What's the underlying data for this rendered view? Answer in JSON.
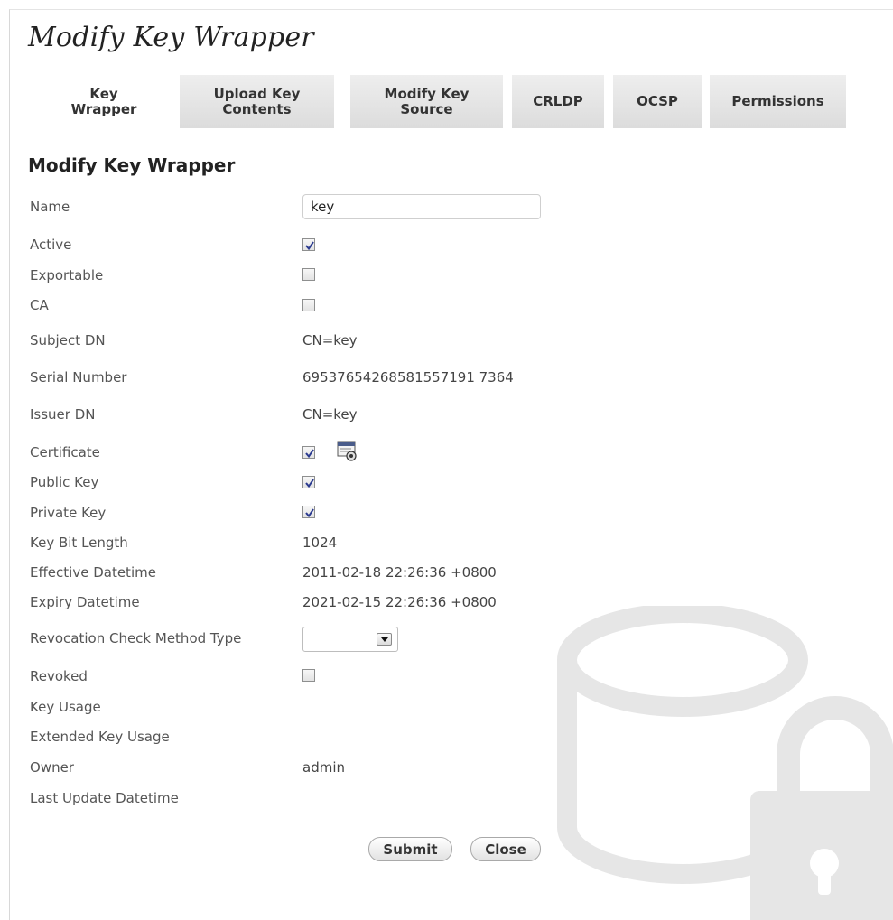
{
  "page": {
    "title": "Modify Key Wrapper"
  },
  "tabs": [
    {
      "label": "Key\nWrapper",
      "active": true
    },
    {
      "label": "Upload Key\nContents"
    },
    {
      "label": "Modify Key\nSource"
    },
    {
      "label": "CRLDP"
    },
    {
      "label": "OCSP"
    },
    {
      "label": "Permissions"
    }
  ],
  "form": {
    "section_title": "Modify Key Wrapper",
    "name": {
      "label": "Name",
      "value": "key"
    },
    "active": {
      "label": "Active",
      "checked": true
    },
    "exportable": {
      "label": "Exportable",
      "checked": false
    },
    "ca": {
      "label": "CA",
      "checked": false
    },
    "subject_dn": {
      "label": "Subject DN",
      "value": "CN=key"
    },
    "serial_number": {
      "label": "Serial Number",
      "value": "69537654268581557191 7364"
    },
    "issuer_dn": {
      "label": "Issuer DN",
      "value": "CN=key"
    },
    "certificate": {
      "label": "Certificate",
      "checked": true,
      "icon": "certificate-view-icon"
    },
    "public_key": {
      "label": "Public Key",
      "checked": true
    },
    "private_key": {
      "label": "Private Key",
      "checked": true
    },
    "key_bit_length": {
      "label": "Key Bit Length",
      "value": "1024"
    },
    "effective_datetime": {
      "label": "Effective Datetime",
      "value": "2011-02-18 22:26:36 +0800"
    },
    "expiry_datetime": {
      "label": "Expiry Datetime",
      "value": "2021-02-15 22:26:36 +0800"
    },
    "revocation_check": {
      "label": "Revocation Check Method Type",
      "value": ""
    },
    "revoked": {
      "label": "Revoked",
      "checked": false
    },
    "key_usage": {
      "label": "Key Usage",
      "value": ""
    },
    "extended_key_usage": {
      "label": "Extended Key Usage",
      "value": ""
    },
    "owner": {
      "label": "Owner",
      "value": "admin"
    },
    "last_update_datetime": {
      "label": "Last Update Datetime",
      "value": ""
    }
  },
  "buttons": {
    "submit": "Submit",
    "close": "Close"
  },
  "watermark": {
    "icon": "database-lock-icon"
  },
  "colors": {
    "tab_bg": "#e3e3e3",
    "check": "#2b3a8f",
    "watermark": "#e6e6e6"
  }
}
